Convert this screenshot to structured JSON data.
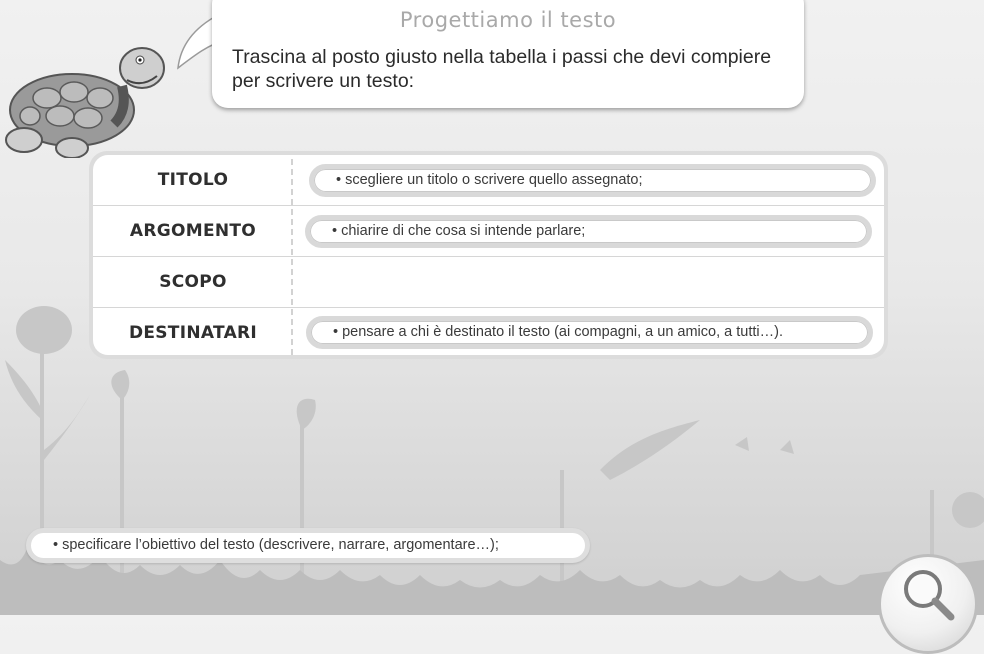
{
  "header": {
    "title": "Progettiamo il testo",
    "instruction": "Trascina al posto giusto nella tabella i passi che devi compiere per scrivere un testo:"
  },
  "table": {
    "rows": [
      {
        "label": "TITOLO",
        "answer": "• scegliere un titolo o scrivere quello assegnato;"
      },
      {
        "label": "ARGOMENTO",
        "answer": "• chiarire di che cosa si intende parlare;"
      },
      {
        "label": "SCOPO",
        "answer": ""
      },
      {
        "label": "DESTINATARI",
        "answer": "• pensare a chi è destinato il testo (ai compagni, a un amico, a tutti…)."
      }
    ]
  },
  "draggable_item": "• specificare l’obiettivo del testo (descrivere, narrare, argomentare…);",
  "icons": {
    "mascot": "turtle-mascot",
    "zoom": "magnifier-icon"
  },
  "colors": {
    "background": "#e9e9e9",
    "title": "#a9a9a9",
    "text": "#2f2f2f"
  }
}
